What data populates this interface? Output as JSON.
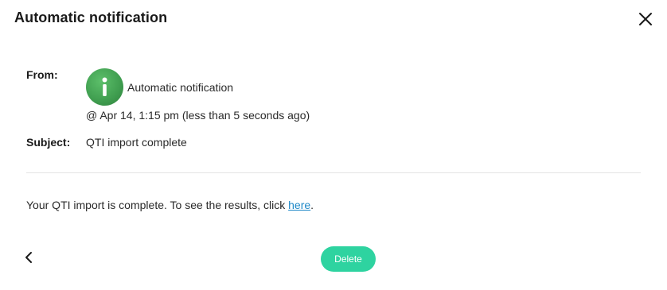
{
  "dialog": {
    "title": "Automatic notification"
  },
  "header": {
    "from_label": "From:",
    "sender_name": "Automatic notification",
    "timestamp": "@ Apr 14, 1:15 pm (less than 5 seconds ago)",
    "subject_label": "Subject:",
    "subject": "QTI import complete"
  },
  "body": {
    "text_before_link": "Your QTI import is complete. To see the results, click ",
    "link_text": "here",
    "text_after_link": "."
  },
  "footer": {
    "delete_label": "Delete"
  },
  "icons": {
    "close": "close-icon",
    "back": "chevron-left-icon",
    "avatar": "info-icon"
  },
  "colors": {
    "avatar_green": "#43a553",
    "delete_button": "#2ed3a0",
    "link": "#1e88c7"
  }
}
